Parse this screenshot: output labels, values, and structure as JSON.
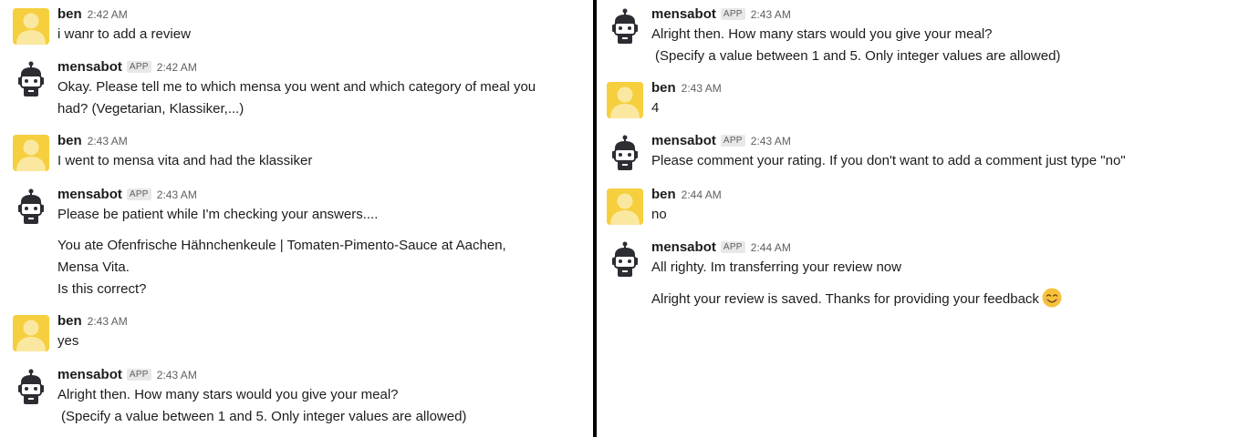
{
  "app_badge": "APP",
  "colors": {
    "user_avatar": "#f6cf3f",
    "bot_avatar": "#2b2d33",
    "divider": "#000000"
  },
  "left": [
    {
      "kind": "user",
      "name": "ben",
      "time": "2:42 AM",
      "lines": [
        "i wanr to add a review"
      ]
    },
    {
      "kind": "bot",
      "name": "mensabot",
      "time": "2:42 AM",
      "lines": [
        "Okay. Please tell me to which mensa you went and which category of meal you",
        "had? (Vegetarian, Klassiker,...)"
      ]
    },
    {
      "kind": "user",
      "name": "ben",
      "time": "2:43 AM",
      "lines": [
        "I went to mensa vita and had the klassiker"
      ]
    },
    {
      "kind": "bot",
      "name": "mensabot",
      "time": "2:43 AM",
      "lines": [
        "Please be patient while I'm checking your answers...."
      ],
      "extra": [
        "You ate Ofenfrische Hähnchenkeule | Tomaten-Pimento-Sauce at Aachen,",
        "Mensa Vita.",
        "Is this correct?"
      ]
    },
    {
      "kind": "user",
      "name": "ben",
      "time": "2:43 AM",
      "lines": [
        "yes"
      ]
    },
    {
      "kind": "bot",
      "name": "mensabot",
      "time": "2:43 AM",
      "lines": [
        "Alright then. How many stars would you give your meal?",
        " (Specify a value between 1 and 5. Only integer values are allowed)"
      ]
    }
  ],
  "right": [
    {
      "kind": "bot",
      "name": "mensabot",
      "time": "2:43 AM",
      "lines": [
        "Alright then. How many stars would you give your meal?",
        " (Specify a value between 1 and 5. Only integer values are allowed)"
      ]
    },
    {
      "kind": "user",
      "name": "ben",
      "time": "2:43 AM",
      "lines": [
        "4"
      ]
    },
    {
      "kind": "bot",
      "name": "mensabot",
      "time": "2:43 AM",
      "lines": [
        "Please comment your rating. If you don't want to add a comment just type \"no\""
      ]
    },
    {
      "kind": "user",
      "name": "ben",
      "time": "2:44 AM",
      "lines": [
        "no"
      ]
    },
    {
      "kind": "bot",
      "name": "mensabot",
      "time": "2:44 AM",
      "lines": [
        "All righty. Im transferring your review now"
      ],
      "extra": [
        "Alright your review is saved. Thanks for providing your feedback"
      ],
      "emoji": "smiling-face-emoji"
    }
  ]
}
